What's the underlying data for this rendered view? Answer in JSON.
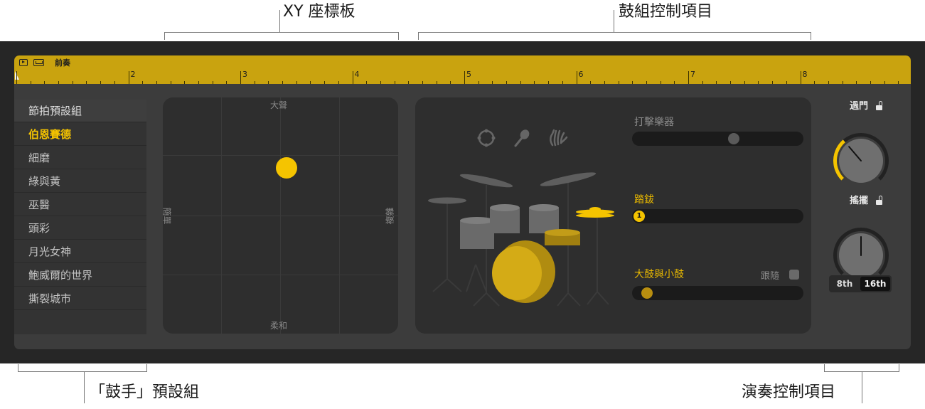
{
  "callouts": {
    "xy_pad": "XY 座標板",
    "drum_kit_controls": "鼓組控制項目",
    "drummer_presets": "「鼓手」預設組",
    "performance_controls": "演奏控制項目"
  },
  "header": {
    "region_name": "前奏",
    "bar_numbers": [
      "2",
      "3",
      "4",
      "5",
      "6",
      "7",
      "8"
    ]
  },
  "presets": {
    "heading": "節拍預設組",
    "items": [
      "伯恩賽德",
      "細磨",
      "綠與黃",
      "巫醫",
      "頭彩",
      "月光女神",
      "鮑威爾的世界",
      "撕裂城市"
    ],
    "selected": "伯恩賽德"
  },
  "xy_pad": {
    "top": "大聲",
    "bottom": "柔和",
    "left": "簡單",
    "right": "複雜"
  },
  "drum_kit": {
    "instrument_icons": [
      "tambourine-icon",
      "shaker-icon",
      "hand-clap-icon"
    ],
    "percussion_label": "打擊樂器",
    "percussion_level": 0.6,
    "hihat_label": "踏鈸",
    "hihat_value": "1",
    "kick_snare_label": "大鼓與小鼓",
    "follow_label": "跟隨",
    "follow_checked": false,
    "kick_snare_level": 0.05
  },
  "performance": {
    "fills_label": "過門",
    "fills_level": 0.35,
    "swing_label": "搖擺",
    "swing_level": 0.5,
    "resolution_options": [
      "8th",
      "16th"
    ],
    "resolution_selected": "16th"
  },
  "colors": {
    "accent": "#f5c400",
    "region": "#c9a30f",
    "background": "#262626"
  }
}
